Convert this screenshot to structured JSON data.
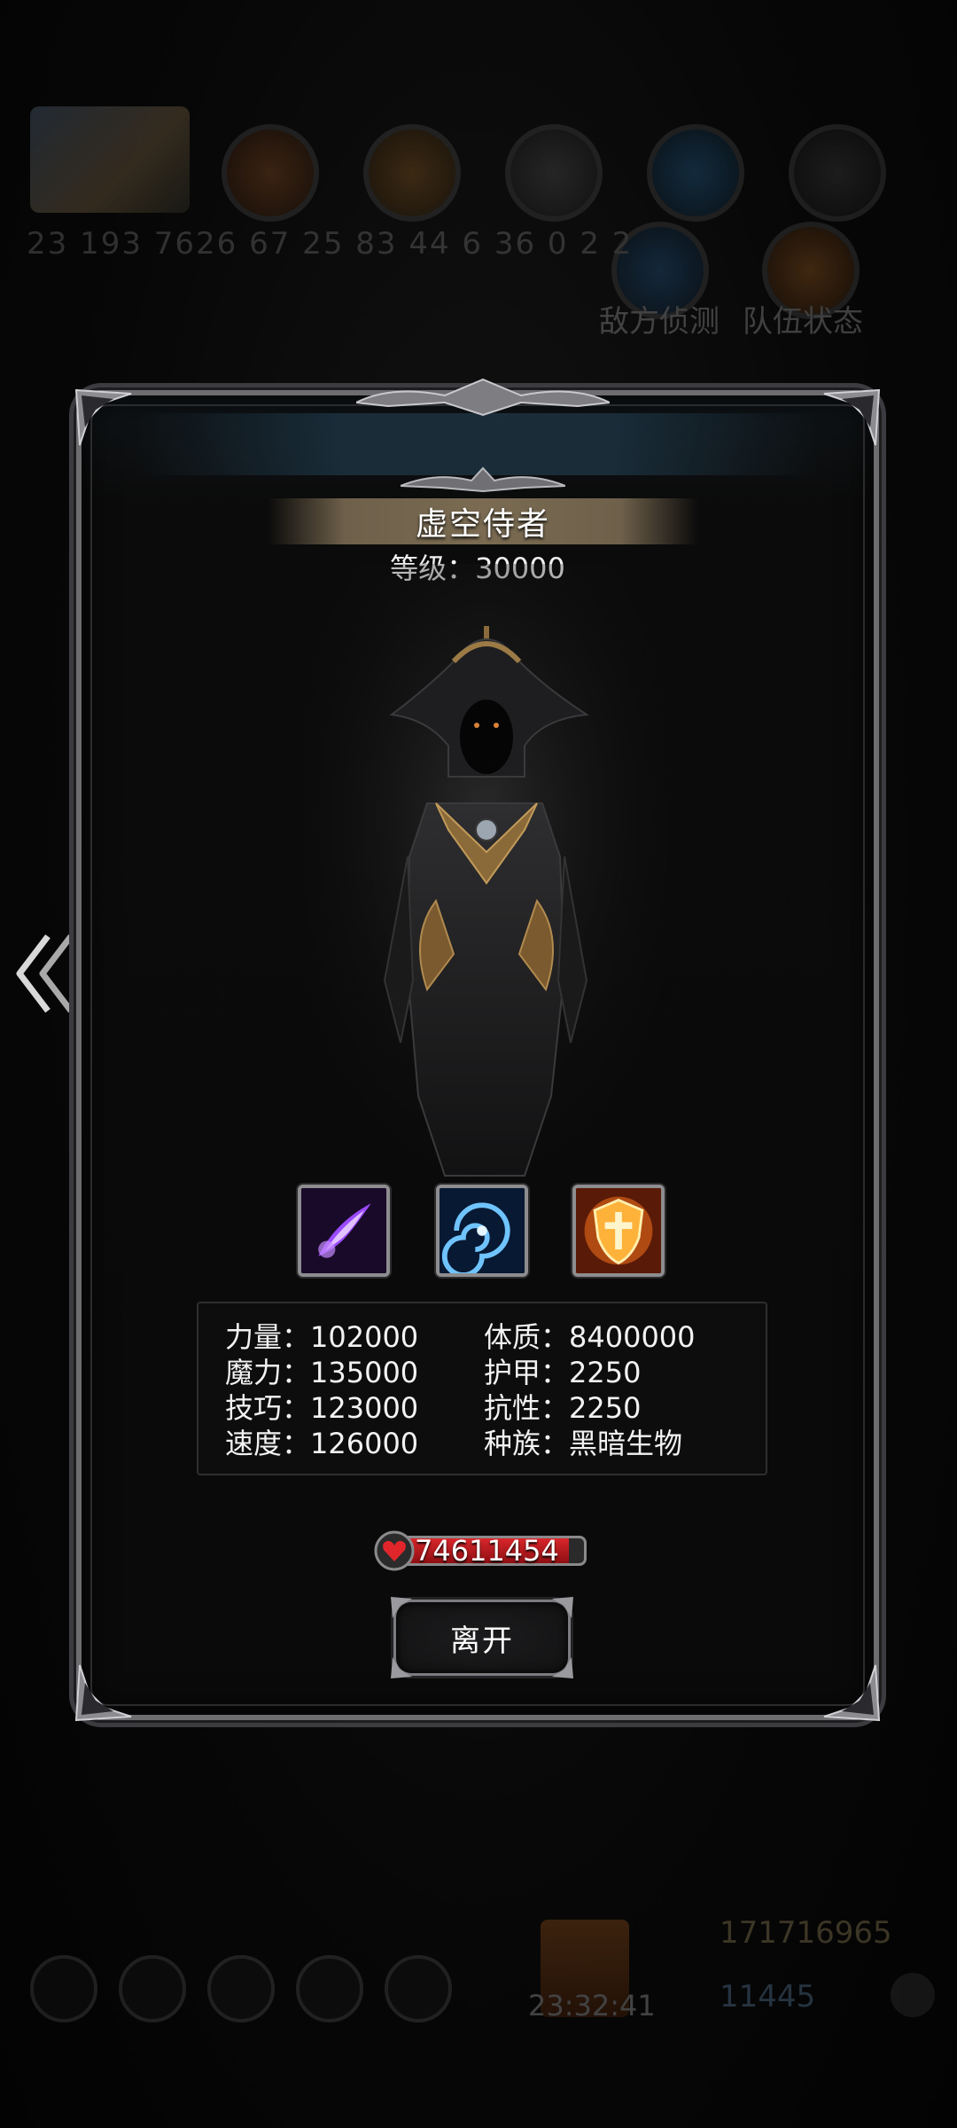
{
  "background": {
    "stats_line": "23 193 7626 67 25 83 44 6 36 0 2 2",
    "labels": [
      "敌方侦测",
      "队伍状态"
    ],
    "timer": "23:32:41",
    "gold": "171716965",
    "gems": "11445"
  },
  "enemy": {
    "name": "虚空侍者",
    "level_line": "等级：30000",
    "skills": [
      "void-bolt-icon",
      "vortex-icon",
      "holy-shield-icon"
    ],
    "stats_left": [
      "力量：102000",
      "魔力：135000",
      "技巧：123000",
      "速度：126000"
    ],
    "stats_right": [
      "体质：8400000",
      "护甲：2250",
      "抗性：2250",
      "种族：黑暗生物"
    ],
    "hp": "74611454",
    "hp_fraction": 0.92
  },
  "buttons": {
    "leave": "离开"
  },
  "colors": {
    "hp_red": "#d8262b",
    "frame": "#6d6d70",
    "name_bar": "#7a6b52"
  }
}
